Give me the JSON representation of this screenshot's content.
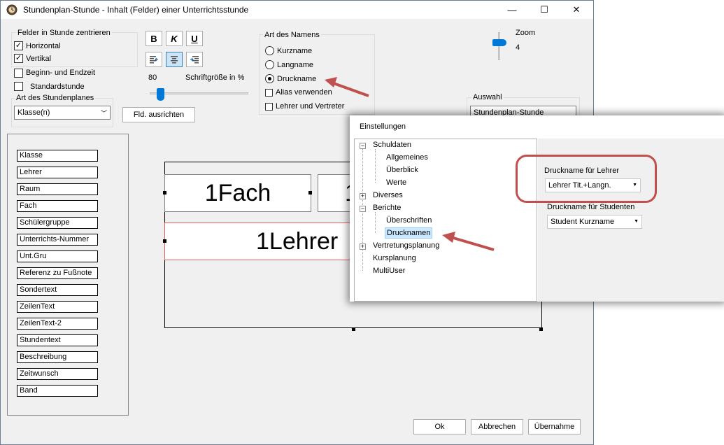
{
  "window": {
    "title": "Stundenplan-Stunde - Inhalt (Felder) einer Unterrichtsstunde",
    "minimize": "—",
    "maximize": "☐",
    "close": "✕"
  },
  "center_group": {
    "title": "Felder in Stunde zentrieren",
    "horizontal": "Horizontal",
    "vertikal": "Vertikal"
  },
  "checks": {
    "begin_end": "Beginn- und Endzeit",
    "standard": "Standardstunde"
  },
  "plan_type": {
    "title": "Art des Stundenplanes",
    "value": "Klasse(n)"
  },
  "format": {
    "bold": "B",
    "italic": "K",
    "underline": "U",
    "font_size_value": "80",
    "font_size_label": "Schriftgröße in %",
    "align_button": "Fld. ausrichten"
  },
  "name_type": {
    "title": "Art des Namens",
    "kurzname": "Kurzname",
    "langname": "Langname",
    "druckname": "Druckname",
    "alias": "Alias verwenden",
    "lehrer_vertreter": "Lehrer und Vertreter"
  },
  "zoom": {
    "label": "Zoom",
    "value": "4"
  },
  "auswahl": {
    "title": "Auswahl",
    "value": "Stundenplan-Stunde"
  },
  "fields": [
    "Klasse",
    "Lehrer",
    "Raum",
    "Fach",
    "Schülergruppe",
    "Unterrichts-Nummer",
    "Unt.Gru",
    "Referenz zu Fußnote",
    "Sondertext",
    "ZeilenText",
    "ZeilenText-2",
    "Stundentext",
    "Beschreibung",
    "Zeitwunsch",
    "Band"
  ],
  "canvas": {
    "cell_fach": "1Fach",
    "cell_second": "1",
    "cell_lehrer": "1Lehrer"
  },
  "buttons": {
    "ok": "Ok",
    "cancel": "Abbrechen",
    "apply": "Übernahme"
  },
  "settings": {
    "title": "Einstellungen",
    "tree": {
      "schuldaten": "Schuldaten",
      "allgemeines": "Allgemeines",
      "ueberblick": "Überblick",
      "werte": "Werte",
      "diverses": "Diverses",
      "berichte": "Berichte",
      "ueberschriften": "Überschriften",
      "drucknamen": "Drucknamen",
      "vertretungsplanung": "Vertretungsplanung",
      "kursplanung": "Kursplanung",
      "multiuser": "MultiUser"
    },
    "druckname_lehrer_label": "Druckname für Lehrer",
    "druckname_lehrer_value": "Lehrer Tit.+Langn.",
    "druckname_studenten_label": "Druckname für Studenten",
    "druckname_studenten_value": "Student Kurzname"
  },
  "colors": {
    "accent_arrow": "#c0504d",
    "selection": "#cce8ff",
    "slider": "#0078d7"
  }
}
